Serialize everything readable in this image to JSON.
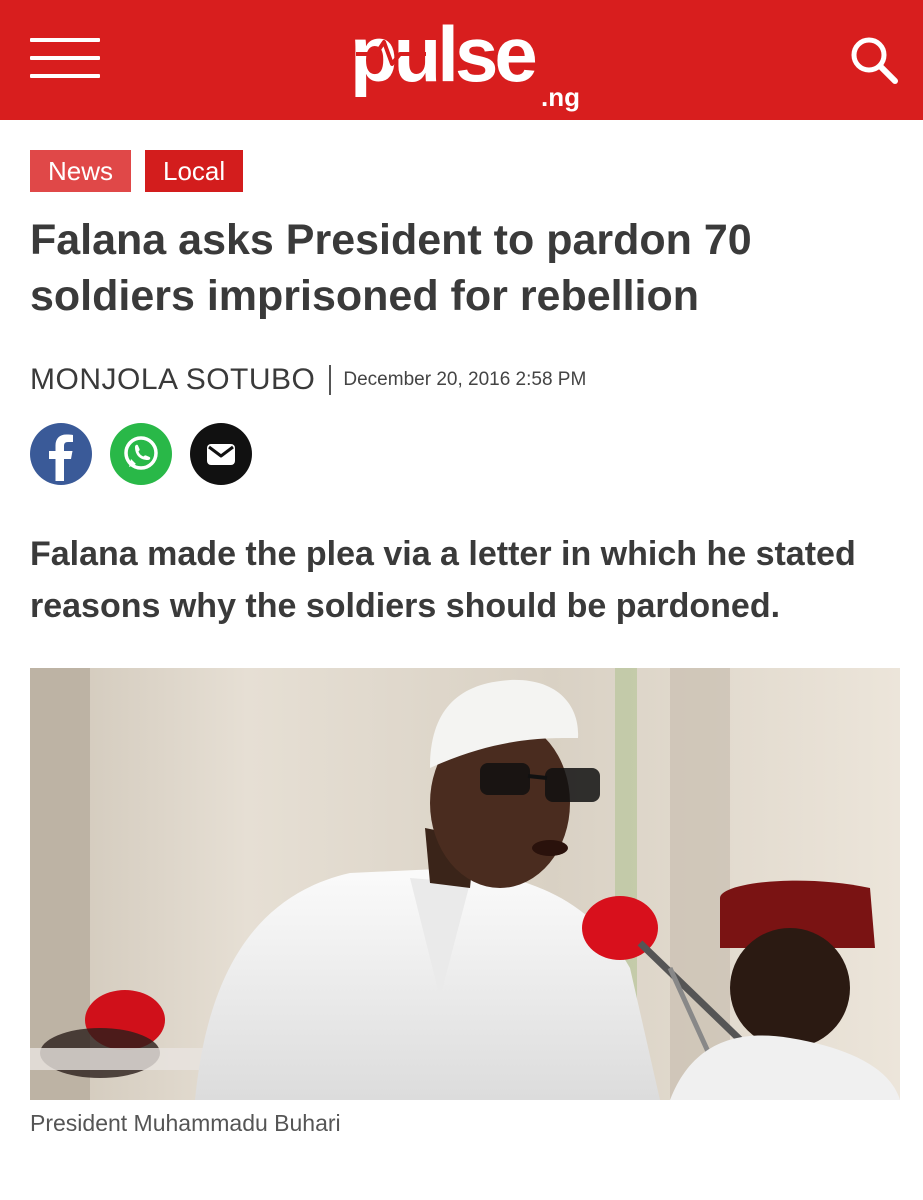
{
  "header": {
    "logo_text": "pulse",
    "logo_suffix": ".ng",
    "brand_color": "#d81e1e",
    "menu_icon": "hamburger-menu-icon",
    "search_icon": "search-icon"
  },
  "tags": [
    {
      "label": "News",
      "color": "#e04848"
    },
    {
      "label": "Local",
      "color": "#d31d1d"
    }
  ],
  "article": {
    "title": "Falana asks President to pardon 70 soldiers imprisoned for rebellion",
    "author": "MONJOLA SOTUBO",
    "date": "December 20, 2016 2:58 PM",
    "lead": "Falana made the plea via a letter in which he stated reasons why the soldiers should be pardoned.",
    "image_caption": "President Muhammadu Buhari"
  },
  "share": [
    {
      "network": "facebook",
      "icon": "facebook-icon",
      "color": "#3a5a98"
    },
    {
      "network": "whatsapp",
      "icon": "whatsapp-icon",
      "color": "#29b848"
    },
    {
      "network": "email",
      "icon": "envelope-icon",
      "color": "#111111"
    }
  ]
}
